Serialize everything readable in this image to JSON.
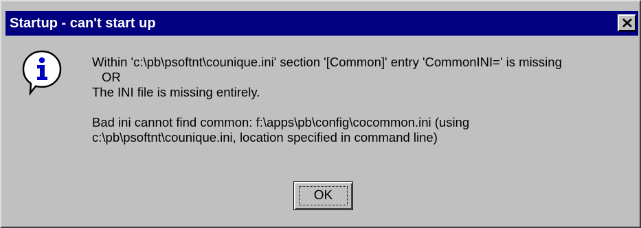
{
  "window": {
    "title": "Startup - can't start up",
    "colors": {
      "titlebar": "#000080",
      "face": "#c0c0c0",
      "title_text": "#ffffff"
    }
  },
  "icon": {
    "name": "info-icon",
    "glyph": "i"
  },
  "message": {
    "line1": "Within 'c:\\pb\\psoftnt\\counique.ini' section '[Common]' entry 'CommonINI=' is missing",
    "line2": "OR",
    "line3": "The INI file is missing entirely.",
    "line4": "Bad ini cannot find common: f:\\apps\\pb\\config\\cocommon.ini (using",
    "line5": "c:\\pb\\psoftnt\\counique.ini, location specified in command line)"
  },
  "buttons": {
    "ok_label": "OK",
    "close_icon": "close-icon"
  }
}
